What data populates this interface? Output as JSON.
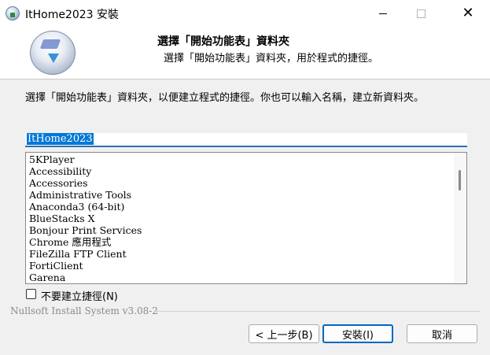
{
  "window": {
    "title": "ItHome2023 安裝",
    "icon": "installer-disc-icon"
  },
  "header": {
    "title": "選擇「開始功能表」資料夾",
    "subtitle": "選擇「開始功能表」資料夾，用於程式的捷徑。"
  },
  "body": {
    "description": "選擇「開始功能表」資料夾，以便建立程式的捷徑。你也可以輸入名稱，建立新資料夾。",
    "folder_name_value": "ItHome2023",
    "folders": [
      "5KPlayer",
      "Accessibility",
      "Accessories",
      "Administrative Tools",
      "Anaconda3 (64-bit)",
      "BlueStacks X",
      "Bonjour Print Services",
      "Chrome 應用程式",
      "FileZilla FTP Client",
      "FortiClient",
      "Garena"
    ],
    "no_shortcuts_label": "不要建立捷徑(N)",
    "no_shortcuts_checked": false
  },
  "footer": {
    "brand": "Nullsoft Install System v3.08-2",
    "back_label": "< 上一步(B)",
    "install_label": "安裝(I)",
    "cancel_label": "取消"
  }
}
